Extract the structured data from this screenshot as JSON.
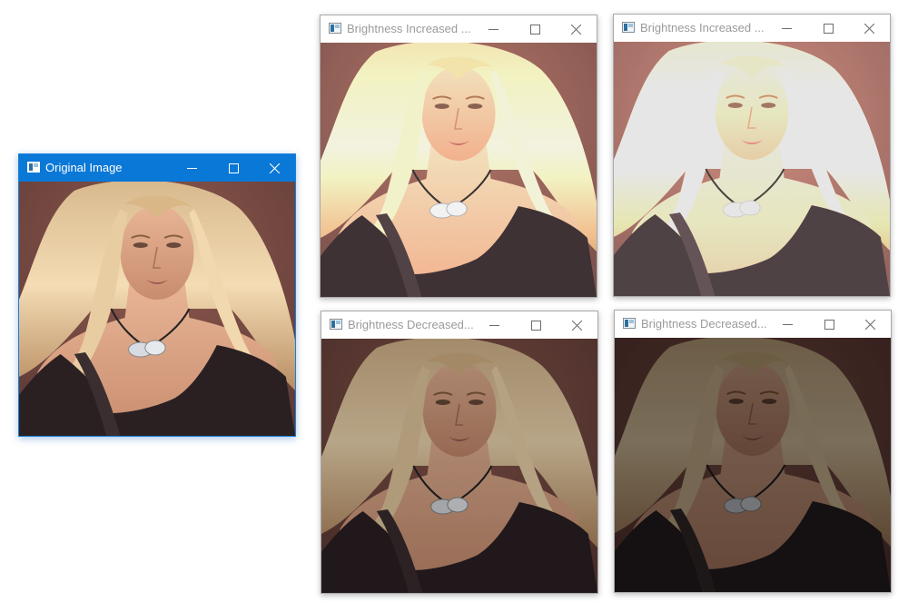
{
  "windows": [
    {
      "id": "original",
      "title": "Original Image",
      "active": true,
      "filter": "none"
    },
    {
      "id": "inc1",
      "title": "Brightness Increased ...",
      "active": false,
      "filter": "brightness(1.3) contrast(0.9)"
    },
    {
      "id": "inc2",
      "title": "Brightness Increased ...",
      "active": false,
      "filter": "brightness(1.6) contrast(0.8)"
    },
    {
      "id": "dec1",
      "title": "Brightness Decreased...",
      "active": false,
      "filter": "brightness(0.75)"
    },
    {
      "id": "dec2",
      "title": "Brightness Decreased...",
      "active": false,
      "filter": "brightness(0.5)"
    }
  ],
  "icons": {
    "app": "app-window-icon",
    "minimize": "minimize-icon",
    "maximize": "maximize-icon",
    "close": "close-icon"
  },
  "colors": {
    "active_titlebar": "#0a78d7",
    "inactive_title_text": "#9a9a9a"
  }
}
